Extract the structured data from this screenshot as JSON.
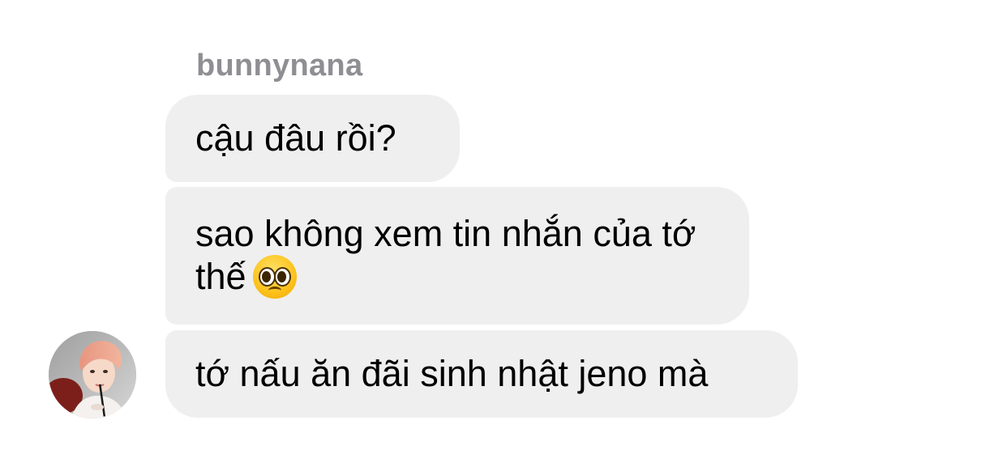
{
  "chat": {
    "sender_name": "bunnynana",
    "messages": [
      {
        "text": "cậu đâu rồi?"
      },
      {
        "text": "sao không xem tin nhắn của tớ thế",
        "emoji": "pleading-face-emoji"
      },
      {
        "text": "tớ nấu ăn đãi sinh nhật jeno mà"
      }
    ],
    "avatar": {
      "icon": "profile-photo"
    }
  },
  "colors": {
    "bubble_background": "#efefef",
    "sender_name": "#8e8e93",
    "text": "#000000",
    "background": "#ffffff"
  }
}
